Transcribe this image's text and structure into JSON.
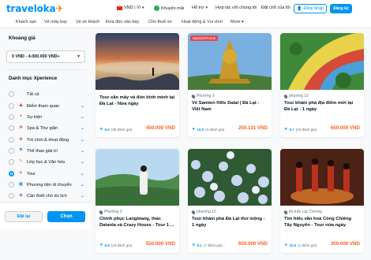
{
  "header": {
    "logo": "traveloka",
    "currency": "VND | Vi",
    "promo": "Khuyến mãi",
    "support": "Hỗ trợ",
    "partner": "Hợp tác với chúng tôi",
    "saved": "Đặt chỗ của tôi",
    "login": "Đăng Nhập",
    "register": "Đăng ký"
  },
  "nav": [
    "Khách sạn",
    "Vé máy bay",
    "Vé xe khách",
    "Đưa đón sân bay",
    "Cho thuê xe",
    "Hoạt động & Vui chơi",
    "More"
  ],
  "sidebar": {
    "price_heading": "Khoảng giá",
    "price_value": "0 VND - 4.000.000 VND+",
    "category_heading": "Danh mục Xperience",
    "reset_label": "Đặt lại",
    "choose_label": "Chọn",
    "categories": [
      {
        "label": "Tất cả",
        "icon": "",
        "checked": false,
        "expand": false
      },
      {
        "label": "Điểm tham quan",
        "icon": "attraction-icon",
        "checked": false,
        "expand": true
      },
      {
        "label": "Sự kiện",
        "icon": "event-icon",
        "checked": false,
        "expand": true
      },
      {
        "label": "Spa & Thư giãn",
        "icon": "spa-icon",
        "checked": false,
        "expand": true
      },
      {
        "label": "Trò chơi & Hoạt động",
        "icon": "game-icon",
        "checked": false,
        "expand": true
      },
      {
        "label": "Thể thao giải trí",
        "icon": "sport-icon",
        "checked": false,
        "expand": true
      },
      {
        "label": "Lớp học & Văn hóa",
        "icon": "class-icon",
        "checked": false,
        "expand": true
      },
      {
        "label": "Tour",
        "icon": "tour-icon",
        "checked": true,
        "expand": true
      },
      {
        "label": "Phương tiện di chuyển",
        "icon": "transport-icon",
        "checked": false,
        "expand": true
      },
      {
        "label": "Cần thiết cho du lịch",
        "icon": "travel-icon",
        "checked": false,
        "expand": true
      }
    ]
  },
  "cards": [
    {
      "location": "",
      "title": "Tour săn mây và đón bình minh tại Đà Lạt - Nửa ngày",
      "score": "9.6",
      "reviews": "(38 đánh giá)",
      "price": "450.000 VND",
      "promo": ""
    },
    {
      "location": "Phường 3",
      "title": "Vé Samten Hills Dalat | Đà Lạt - Việt Nam",
      "score": "10.0",
      "reviews": "(3 đánh giá)",
      "price": "250.131 VND",
      "promo": "Special Promo"
    },
    {
      "location": "phường 10",
      "title": "Tour khám phá địa điểm mới tại Đà Lạt - 1 ngày",
      "score": "9.7",
      "reviews": "(23 đánh giá)",
      "price": "650.000 VND",
      "promo": ""
    },
    {
      "location": "Phường 3",
      "title": "Chinh phục Langbiang, thác Datanla và Crazy House - Tour 1 ...",
      "score": "9.6",
      "reviews": "(18 đánh giá)",
      "price": "550.000 VND",
      "promo": ""
    },
    {
      "location": "phường 10",
      "title": "Tour khám phá Đà Lạt thơ mộng - 1 ngày",
      "score": "9.1",
      "reviews": "(7 đánh giá)",
      "price": "650.000 VND",
      "promo": ""
    },
    {
      "location": "thị trấn Lạc Dương",
      "title": "Tìm hiểu văn hoá Cồng Chiêng Tây Nguyên - Tour nửa ngày",
      "score": "10.0",
      "reviews": "(1 đánh giá)",
      "price": "300.000 VND",
      "promo": ""
    }
  ]
}
